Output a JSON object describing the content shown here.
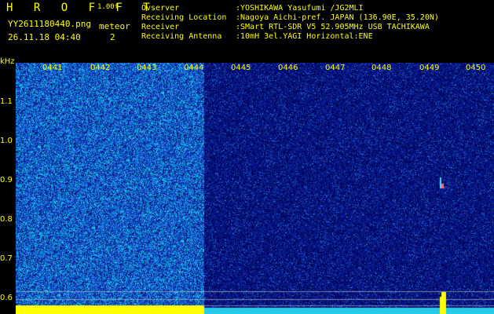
{
  "app": {
    "logo": "H R O F F T",
    "version": "1.00f"
  },
  "file": {
    "name": "YY2611180440.png",
    "datetime": "26.11.18 04:40"
  },
  "meteor": {
    "label": "meteor",
    "count": "2"
  },
  "info": {
    "observer_label": "Ovserver",
    "observer_value": ":YOSHIKAWA Yasufumi /JG2MLI",
    "location_label": "Receiving Location",
    "location_value": ":Nagoya Aichi-pref. JAPAN (136.90E, 35.20N)",
    "receiver_label": "Receiver",
    "receiver_value": ":SMart RTL-SDR V5 52.905MHz USB TACHIKAWA",
    "antenna_label": "Receiving Antenna",
    "antenna_value": ":10mH 3el.YAGI Horizontal:ENE"
  },
  "axis": {
    "unit": "kHz",
    "y_labels": [
      "1.1",
      "1.0",
      "0.9",
      "0.8",
      "0.7",
      "0.6"
    ],
    "time_labels": [
      "0441",
      "0442",
      "0443",
      "0444",
      "0445",
      "0446",
      "0447",
      "0448",
      "0449",
      "0450"
    ]
  },
  "colors": {
    "text": "#ffff00",
    "bg": "#000000",
    "dark_noise": "#000066",
    "bright_noise": "#1a4bd0"
  }
}
